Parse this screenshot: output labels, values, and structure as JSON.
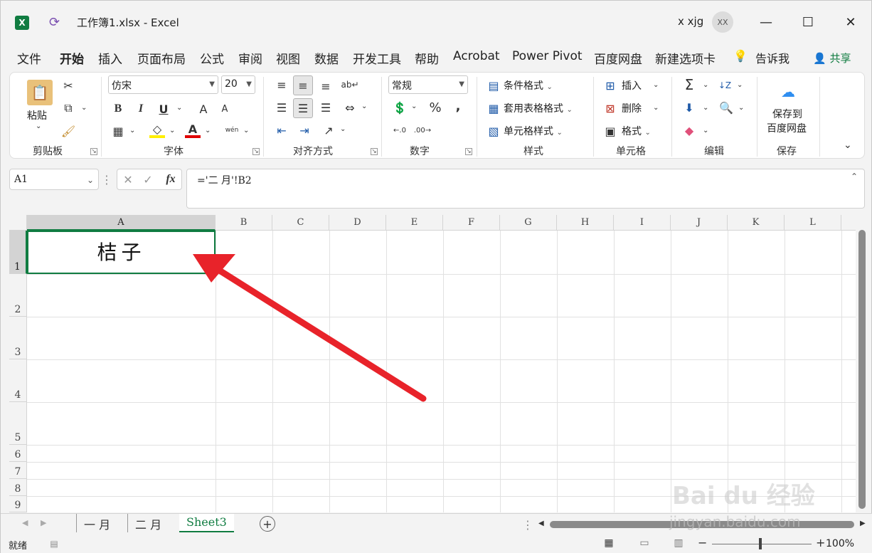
{
  "window": {
    "title": "工作簿1.xlsx  -  Excel",
    "user_name": "x xjg",
    "avatar_initials": "XX",
    "minimize_glyph": "—",
    "maximize_glyph": "☐",
    "close_glyph": "✕"
  },
  "menu": {
    "tabs": [
      "文件",
      "开始",
      "插入",
      "页面布局",
      "公式",
      "审阅",
      "视图",
      "数据",
      "开发工具",
      "帮助",
      "Acrobat",
      "Power Pivot",
      "百度网盘",
      "新建选项卡"
    ],
    "tell_me": "告诉我",
    "share": "共享"
  },
  "ribbon": {
    "clipboard": {
      "paste": "粘贴",
      "label": "剪贴板"
    },
    "font": {
      "name": "仿宋",
      "size": "20",
      "bold": "B",
      "italic": "I",
      "underline": "U",
      "grow": "A",
      "shrink": "A",
      "color_a": "A",
      "phonetic": "wén",
      "label": "字体"
    },
    "alignment": {
      "label": "对齐方式"
    },
    "number": {
      "format": "常规",
      "percent": "%",
      "comma": ",",
      "label": "数字"
    },
    "styles": {
      "conditional": "条件格式",
      "table": "套用表格格式",
      "cell": "单元格样式",
      "label": "样式"
    },
    "cells": {
      "insert": "插入",
      "delete": "删除",
      "format": "格式",
      "label": "单元格"
    },
    "editing": {
      "sum": "Σ",
      "label": "编辑"
    },
    "save": {
      "line1": "保存到",
      "line2": "百度网盘",
      "label": "保存"
    }
  },
  "formula_bar": {
    "name_box": "A1",
    "fx": "fx",
    "formula": "='二  月'!B2"
  },
  "grid": {
    "columns": [
      "A",
      "B",
      "C",
      "D",
      "E",
      "F",
      "G",
      "H",
      "I",
      "J",
      "K",
      "L"
    ],
    "rows": [
      "1",
      "2",
      "3",
      "4",
      "5",
      "6",
      "7",
      "8",
      "9"
    ],
    "selected_cell_value": "桔子"
  },
  "sheets": {
    "tabs": [
      "一  月",
      "二  月",
      "Sheet3"
    ],
    "active": "Sheet3",
    "add": "+"
  },
  "status": {
    "ready": "就绪",
    "zoom": "100%"
  },
  "watermark": {
    "brand": "Bai du 经验",
    "url": "jingyan.baidu.com"
  },
  "colors": {
    "excel_green": "#107c41",
    "arrow_red": "#e8232a"
  }
}
